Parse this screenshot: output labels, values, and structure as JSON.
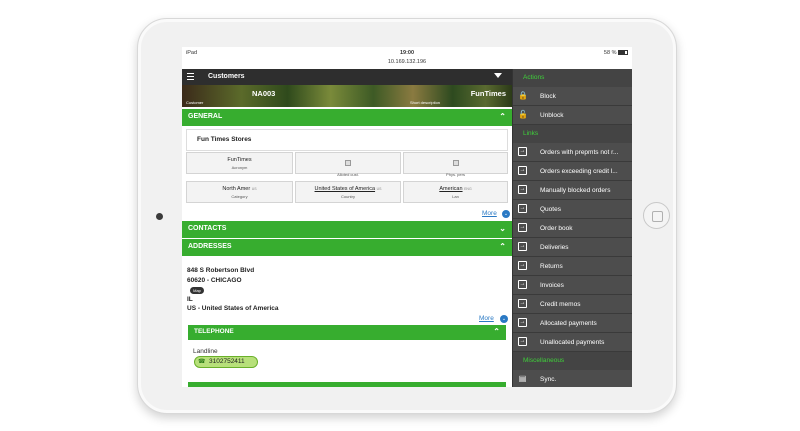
{
  "statusbar": {
    "device": "iPad",
    "time": "19:00",
    "url": "10.169.132.196",
    "battery": "58 %"
  },
  "topbar": {
    "title": "Customers"
  },
  "banner": {
    "customer_id": "NA003",
    "short_name": "FunTimes",
    "customer_label": "Customer",
    "desc_label": "Short description"
  },
  "general": {
    "label": "GENERAL",
    "company": "Fun Times Stores",
    "fields": {
      "acronym_value": "FunTimes",
      "acronym_label": "Acronym",
      "alloc_label": "Alloted cust.",
      "phys_label": "Phys. pers",
      "category_value": "North Amer",
      "category_code": "US",
      "category_label": "Category",
      "country_value": "United States of America",
      "country_code": "US",
      "country_label": "Country",
      "lan_value": "American",
      "lan_code": "ENG",
      "lan_label": "Lan"
    },
    "more": "More"
  },
  "contacts": {
    "label": "CONTACTS"
  },
  "addresses": {
    "label": "ADDRESSES",
    "line1": "848 S Robertson Blvd",
    "line2": "60620 - CHICAGO",
    "map": "Map",
    "line3": "IL",
    "line4": "US - United States of America",
    "more": "More"
  },
  "telephone": {
    "label": "TELEPHONE",
    "type": "Landline",
    "number": "3102752411"
  },
  "pane": {
    "actions_label": "Actions",
    "actions": [
      {
        "label": "Block",
        "icon": "lock-icon"
      },
      {
        "label": "Unblock",
        "icon": "unlock-icon"
      }
    ],
    "links_label": "Links",
    "links": [
      "Orders with prepmts not r...",
      "Orders exceeding credit l...",
      "Manually blocked orders",
      "Quotes",
      "Order book",
      "Deliveries",
      "Returns",
      "Invoices",
      "Credit memos",
      "Allocated payments",
      "Unallocated payments"
    ],
    "misc_label": "Miscellaneous",
    "misc": [
      {
        "label": "Sync.",
        "icon": "sync-icon"
      }
    ]
  }
}
